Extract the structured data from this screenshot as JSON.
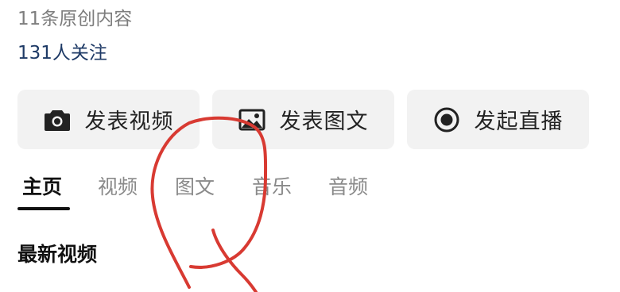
{
  "profile": {
    "original_count_text": "11条原创内容",
    "followers_text": "131人关注"
  },
  "actions": [
    {
      "label": "发表视频",
      "icon": "camera-icon"
    },
    {
      "label": "发表图文",
      "icon": "image-icon"
    },
    {
      "label": "发起直播",
      "icon": "live-record-icon"
    }
  ],
  "tabs": [
    {
      "label": "主页",
      "active": true
    },
    {
      "label": "视频",
      "active": false
    },
    {
      "label": "图文",
      "active": false
    },
    {
      "label": "音乐",
      "active": false
    },
    {
      "label": "音频",
      "active": false
    }
  ],
  "section": {
    "title": "最新视频"
  },
  "colors": {
    "followers_text": "#1e3a66",
    "annotation_stroke": "#d83a32",
    "button_bg": "#f2f2f2"
  }
}
